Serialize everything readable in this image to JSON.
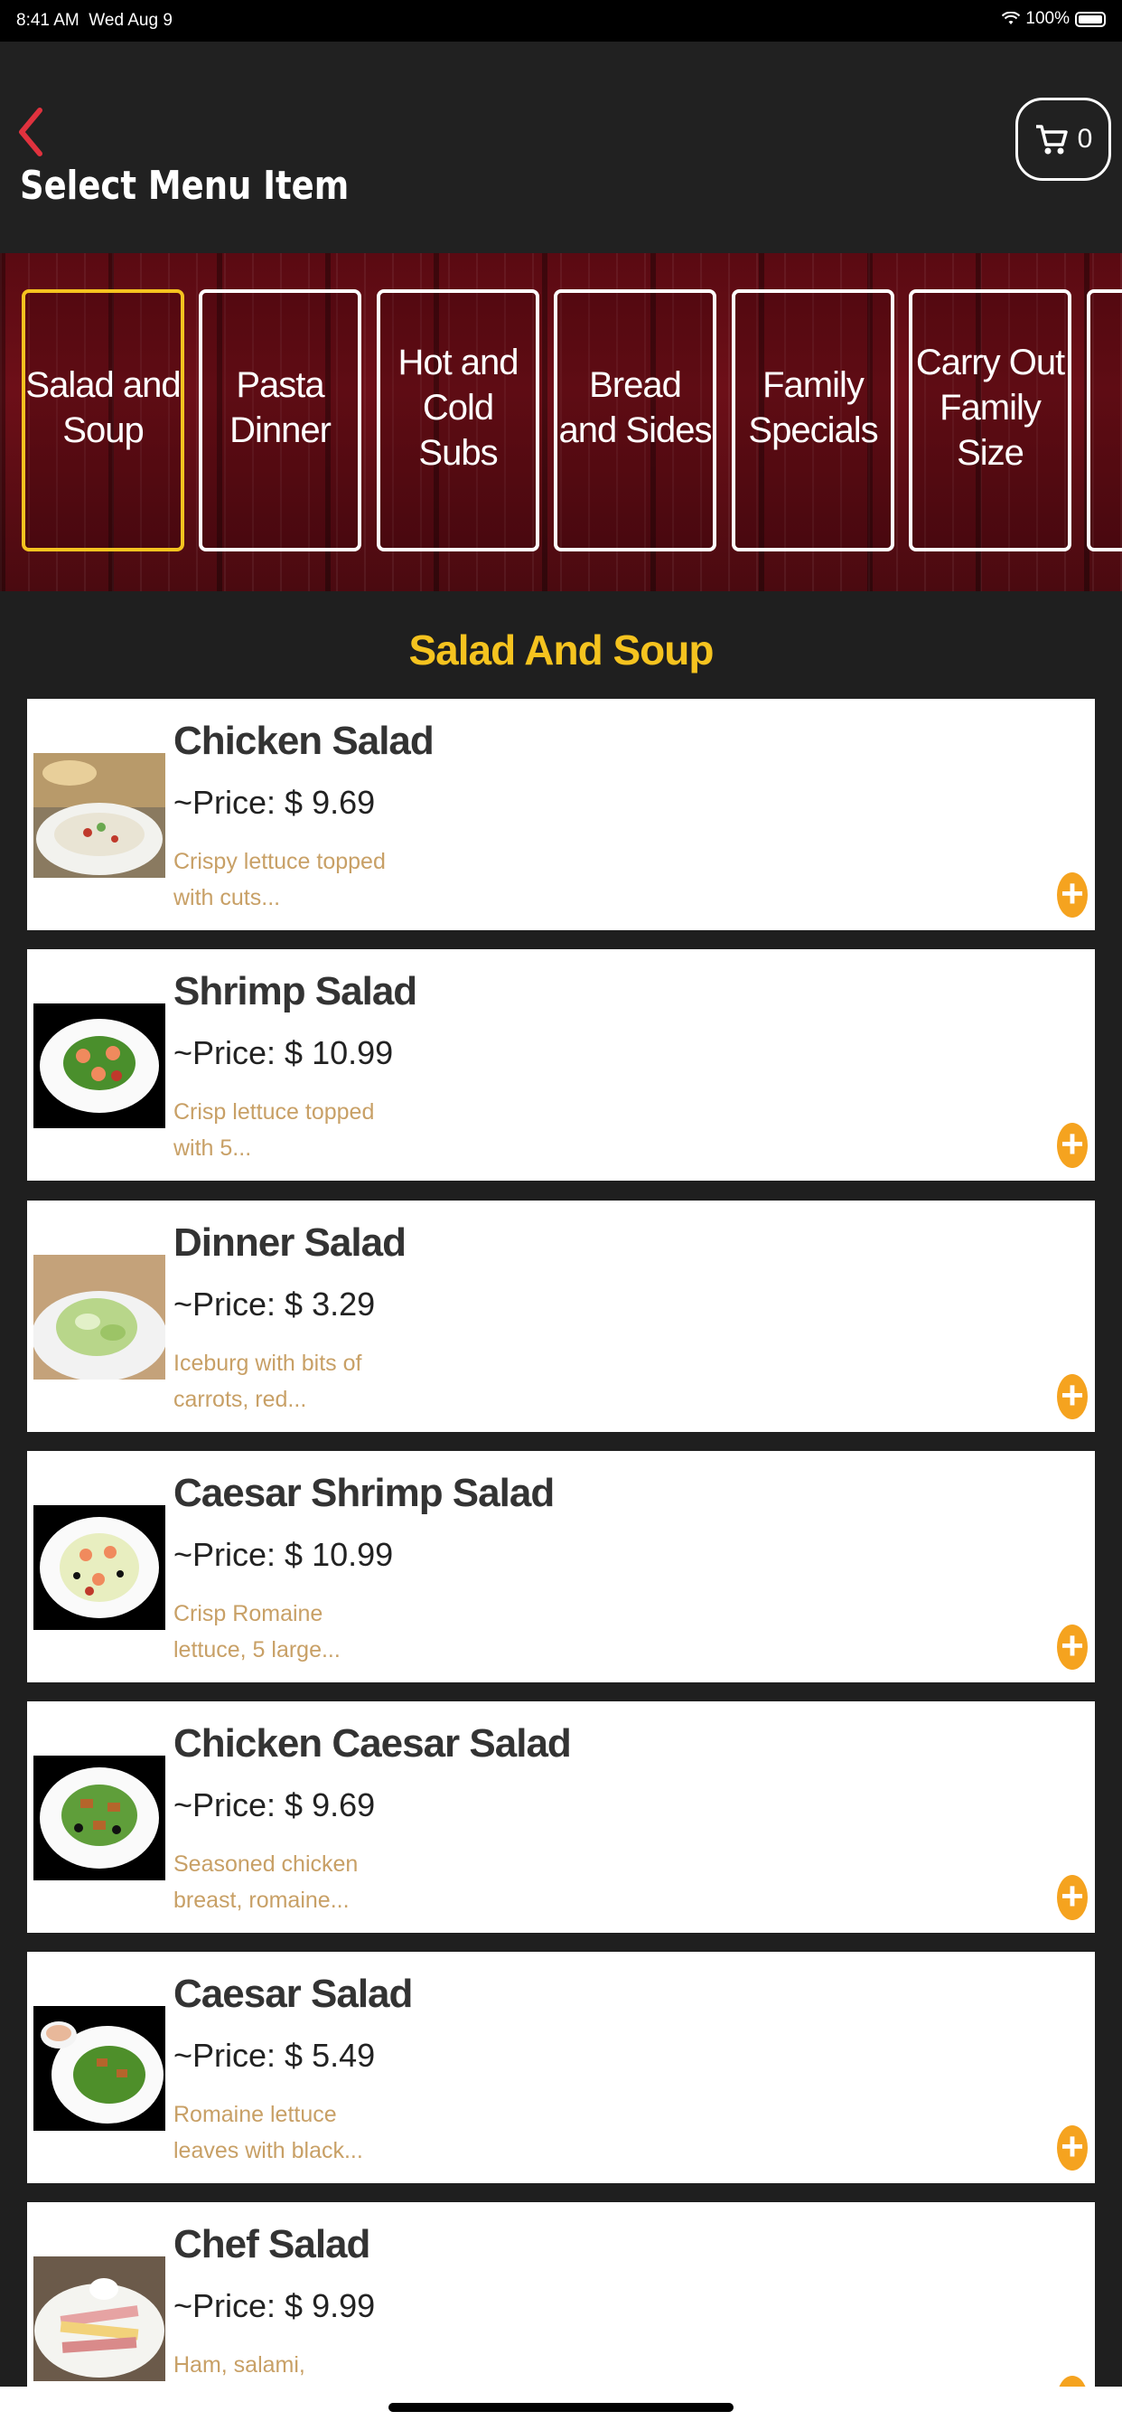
{
  "status_bar": {
    "time": "8:41 AM",
    "date": "Wed Aug 9",
    "battery": "100%"
  },
  "nav": {
    "title": "Select Menu Item",
    "cart_count": "0",
    "back_icon": "chevron-left-icon",
    "cart_icon": "cart-icon"
  },
  "categories": [
    {
      "label": "Salad and Soup",
      "active": true
    },
    {
      "label": "Pasta Dinner",
      "active": false
    },
    {
      "label": "Hot and Cold Subs",
      "active": false
    },
    {
      "label": "Bread and Sides",
      "active": false
    },
    {
      "label": "Family Specials",
      "active": false
    },
    {
      "label": "Carry Out Family Size",
      "active": false
    }
  ],
  "section_title": "Salad And Soup",
  "items": [
    {
      "name": "Chicken Salad",
      "price": "~Price: $ 9.69",
      "desc": "Crispy lettuce topped with cuts..."
    },
    {
      "name": "Shrimp Salad",
      "price": "~Price: $ 10.99",
      "desc": "Crisp lettuce topped with 5..."
    },
    {
      "name": "Dinner Salad",
      "price": "~Price: $ 3.29",
      "desc": "Iceburg with bits of carrots, red..."
    },
    {
      "name": "Caesar Shrimp Salad",
      "price": "~Price: $ 10.99",
      "desc": "Crisp Romaine lettuce, 5 large..."
    },
    {
      "name": "Chicken Caesar Salad",
      "price": "~Price: $ 9.69",
      "desc": "Seasoned chicken breast, romaine..."
    },
    {
      "name": "Caesar Salad",
      "price": "~Price: $ 5.49",
      "desc": "Romaine lettuce leaves with black..."
    },
    {
      "name": "Chef Salad",
      "price": "~Price: $ 9.99",
      "desc": "Ham, salami, American..."
    }
  ],
  "colors": {
    "accent": "#f5c31f",
    "add_button": "#f5a31f",
    "back": "#e0323e"
  }
}
